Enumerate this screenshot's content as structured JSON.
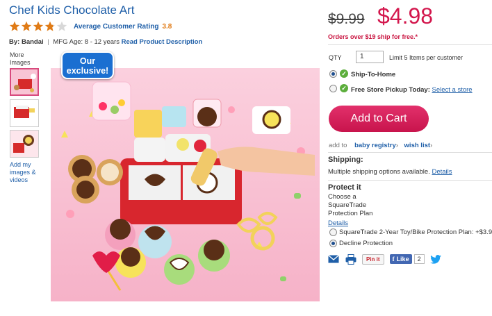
{
  "product": {
    "title": "Chef Kids Chocolate Art",
    "rating_label": "Average Customer Rating",
    "rating_value": "3.8",
    "rating_stars": 3.8,
    "by_label": "By:",
    "brand": "Bandai",
    "age": "MFG Age: 8 - 12 years",
    "read_desc": "Read Product Description",
    "badge_line1": "Our",
    "badge_line2": "exclusive!"
  },
  "gallery": {
    "more_label": "More Images",
    "add_images": "Add my images & videos"
  },
  "pricing": {
    "old_price": "$9.99",
    "new_price": "$4.98",
    "ship_note": "Orders over $19 ship for free.*"
  },
  "order": {
    "qty_label": "QTY",
    "qty_value": "1",
    "qty_limit": "Limit 5 Items per customer",
    "ship_home": "Ship-To-Home",
    "store_pickup": "Free Store Pickup Today:",
    "select_store": "Select a store",
    "add_to_cart": "Add to Cart",
    "add_to": "add to",
    "baby_registry": "baby registry",
    "wish_list": "wish list"
  },
  "shipping": {
    "heading": "Shipping:",
    "text": "Multiple shipping options available.",
    "details": "Details"
  },
  "protect": {
    "heading": "Protect it",
    "line1": "Choose a",
    "line2": "SquareTrade",
    "line3": "Protection Plan",
    "details": "Details",
    "plan_option": "SquareTrade 2-Year Toy/Bike Protection Plan:  +$3.99",
    "decline_option": "Decline Protection"
  },
  "share": {
    "pinit": "Pin it",
    "like": "Like",
    "like_count": "2"
  },
  "colors": {
    "accent": "#d3174d",
    "link": "#1f5fa8",
    "star": "#e07b16"
  }
}
